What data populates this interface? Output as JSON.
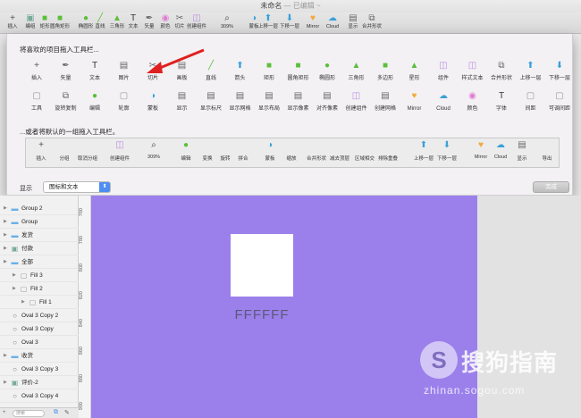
{
  "window": {
    "title": "未命名",
    "title_suffix": " — 已编辑 ~"
  },
  "toolbar": {
    "items": [
      {
        "label": "插入",
        "icon": "plus-icon"
      },
      {
        "label": "编组",
        "icon": "group-icon"
      },
      {
        "label": "矩形",
        "icon": "rectangle-icon"
      },
      {
        "label": "圆角矩形",
        "icon": "rounded-rect-icon"
      },
      {
        "label": "椭圆形",
        "icon": "oval-icon"
      },
      {
        "label": "直线",
        "icon": "line-icon"
      },
      {
        "label": "三角形",
        "icon": "triangle-icon"
      },
      {
        "label": "文本",
        "icon": "text-icon"
      },
      {
        "label": "矢量",
        "icon": "vector-icon"
      },
      {
        "label": "颜色",
        "icon": "color-icon"
      },
      {
        "label": "切片",
        "icon": "slice-icon"
      },
      {
        "label": "创建组件",
        "icon": "create-symbol-icon"
      },
      {
        "label": "309%",
        "icon": "zoom-icon"
      },
      {
        "label": "蒙板",
        "icon": "mask-icon"
      },
      {
        "label": "上移一层",
        "icon": "forward-icon"
      },
      {
        "label": "下移一层",
        "icon": "backward-icon"
      },
      {
        "label": "Mirror",
        "icon": "mirror-icon"
      },
      {
        "label": "Cloud",
        "icon": "cloud-icon"
      },
      {
        "label": "显示",
        "icon": "view-icon"
      },
      {
        "label": "合并形状",
        "icon": "combine-icon"
      }
    ]
  },
  "sheet": {
    "heading_favorites": "将喜欢的项目拖入工具栏...",
    "row1": [
      "插入",
      "矢量",
      "文本",
      "图片",
      "切片",
      "画板",
      "直线",
      "箭头",
      "矩形",
      "圆角矩形",
      "椭圆形",
      "三角形",
      "多边形",
      "星形",
      "组件",
      "样式文本",
      "合并形状",
      "上移一层",
      "下移一层"
    ],
    "row2": [
      "工具",
      "旋转复制",
      "编辑",
      "轮廓",
      "蒙板",
      "显示",
      "显示标尺",
      "显示网格",
      "显示布局",
      "显示像素",
      "对齐像素",
      "创建组件",
      "创建网格",
      "Mirror",
      "Cloud",
      "颜色",
      "字体",
      "间距",
      "可调间距"
    ],
    "heading_default": "...或者将默认的一组拖入工具栏。",
    "default_set": [
      "插入",
      "分组",
      "取消分组",
      "创建组件",
      "309%",
      "编辑",
      "变换",
      "旋转",
      "拼合",
      "蒙板",
      "缩放",
      "合并形状",
      "减去顶层",
      "区域相交",
      "排除重叠",
      "上移一层",
      "下移一层",
      "Mirror",
      "Cloud",
      "显示",
      "导出"
    ],
    "show_label": "显示",
    "show_value": "图标和文本",
    "done_label": "完成"
  },
  "layers": [
    {
      "name": "Group 2",
      "indent": 1,
      "icon": "folder-icon"
    },
    {
      "name": "Group",
      "indent": 1,
      "icon": "folder-icon"
    },
    {
      "name": "发货",
      "indent": 1,
      "icon": "folder-icon"
    },
    {
      "name": "付款",
      "indent": 1,
      "icon": "group-icon"
    },
    {
      "name": "全部",
      "indent": 1,
      "icon": "folder-icon"
    },
    {
      "name": "Fill 3",
      "indent": 2,
      "icon": "shape-icon"
    },
    {
      "name": "Fill 2",
      "indent": 2,
      "icon": "shape-icon"
    },
    {
      "name": "Fill 1",
      "indent": 3,
      "icon": "shape-icon"
    },
    {
      "name": "Oval 3 Copy 2",
      "indent": 1,
      "icon": "oval-icon"
    },
    {
      "name": "Oval 3 Copy",
      "indent": 1,
      "icon": "oval-icon"
    },
    {
      "name": "Oval 3",
      "indent": 1,
      "icon": "oval-icon"
    },
    {
      "name": "收货",
      "indent": 1,
      "icon": "folder-icon"
    },
    {
      "name": "Oval 3 Copy 3",
      "indent": 1,
      "icon": "oval-icon"
    },
    {
      "name": "评价-2",
      "indent": 1,
      "icon": "group-icon"
    },
    {
      "name": "Oval 3 Copy 4",
      "indent": 1,
      "icon": "oval-icon"
    }
  ],
  "search": {
    "placeholder": "搜索"
  },
  "ruler": {
    "ticks": [
      "760",
      "780",
      "800",
      "820",
      "840",
      "860",
      "880",
      "900"
    ]
  },
  "canvas": {
    "artboard_color": "#9b80ec",
    "square_color": "#ffffff",
    "label": "FFFFFF"
  },
  "watermark": {
    "title": "搜狗指南",
    "url": "zhinan.sogou.com"
  }
}
